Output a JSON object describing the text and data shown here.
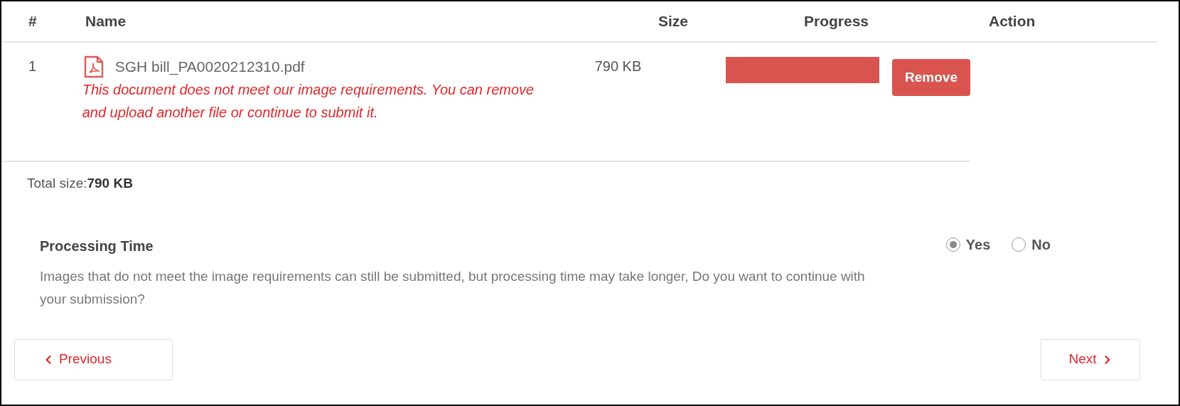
{
  "table": {
    "columns": [
      "#",
      "Name",
      "Size",
      "Progress",
      "Action"
    ],
    "rows": [
      {
        "index": "1",
        "file_name": "SGH bill_PA0020212310.pdf",
        "error": "This document does not meet our image requirements. You can remove and upload another file or continue to submit it.",
        "size": "790 KB",
        "level": 1,
        "action": "Remove"
      }
    ]
  },
  "total": {
    "label": "Total size:",
    "value": "790 KB"
  },
  "processing": {
    "title": "Processing Time",
    "description": "Images that do not meet the image requirements can still be submitted, but processing time may take longer, Do you want to continue with your submission?",
    "options": [
      {
        "label": "Yes",
        "selected": true
      },
      {
        "label": "No",
        "selected": false
      }
    ]
  },
  "buttons": {
    "previous": "Previous",
    "next": "Next"
  }
}
